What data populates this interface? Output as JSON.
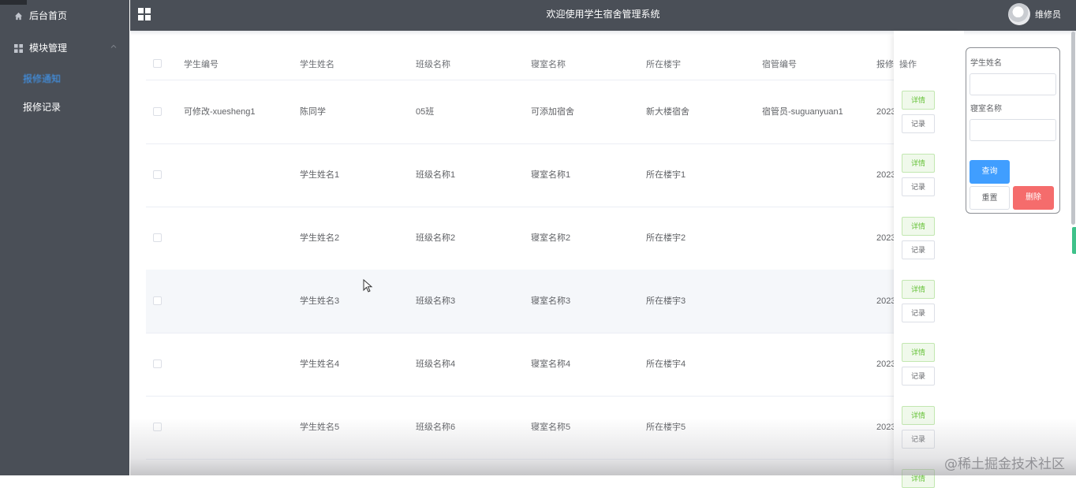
{
  "sidebar": {
    "home_label": "后台首页",
    "module_label": "模块管理",
    "sub_items": [
      {
        "label": "报修通知",
        "active": true
      },
      {
        "label": "报修记录",
        "active": false
      }
    ]
  },
  "header": {
    "title": "欢迎使用学生宿舍管理系统",
    "user": "维修员"
  },
  "table": {
    "headers": [
      "学生编号",
      "学生姓名",
      "班级名称",
      "寝室名称",
      "所在楼宇",
      "宿管编号",
      "报修"
    ],
    "ops_header": "操作",
    "rows": [
      {
        "student_id": "可修改-xuesheng1",
        "name": "陈同学",
        "class": "05班",
        "dorm": "可添加宿舍",
        "building": "新大楼宿舍",
        "manager": "宿管员-suguanyuan1",
        "date": "2023"
      },
      {
        "student_id": "",
        "name": "学生姓名1",
        "class": "班级名称1",
        "dorm": "寝室名称1",
        "building": "所在楼宇1",
        "manager": "",
        "date": "2023"
      },
      {
        "student_id": "",
        "name": "学生姓名2",
        "class": "班级名称2",
        "dorm": "寝室名称2",
        "building": "所在楼宇2",
        "manager": "",
        "date": "2023"
      },
      {
        "student_id": "",
        "name": "学生姓名3",
        "class": "班级名称3",
        "dorm": "寝室名称3",
        "building": "所在楼宇3",
        "manager": "",
        "date": "2023"
      },
      {
        "student_id": "",
        "name": "学生姓名4",
        "class": "班级名称4",
        "dorm": "寝室名称4",
        "building": "所在楼宇4",
        "manager": "",
        "date": "2023"
      },
      {
        "student_id": "",
        "name": "学生姓名5",
        "class": "班级名称6",
        "dorm": "寝室名称5",
        "building": "所在楼宇5",
        "manager": "",
        "date": "2023"
      }
    ],
    "detail_label": "详情",
    "record_label": "记录"
  },
  "search_panel": {
    "name_label": "学生姓名",
    "name_value": "",
    "dorm_label": "寝室名称",
    "dorm_value": "",
    "query_label": "查询",
    "reset_label": "重置",
    "delete_label": "删除"
  },
  "watermark": "@稀土掘金技术社区",
  "colors": {
    "sidebar_bg": "#4a4f57",
    "primary": "#409eff",
    "danger": "#f56c6c",
    "success": "#67c23a"
  }
}
